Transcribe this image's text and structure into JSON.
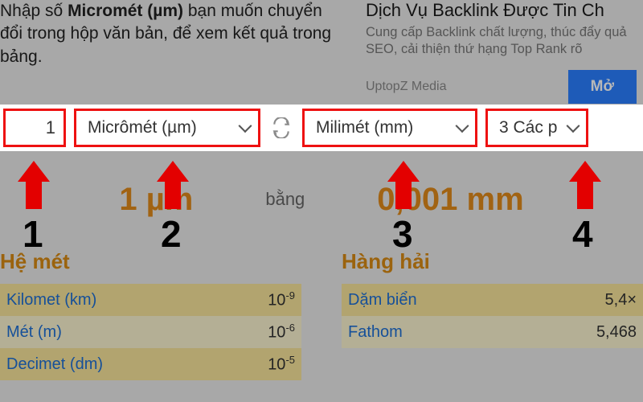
{
  "intro": {
    "line_pre": "Nhập số ",
    "bold": "Micromét (µm)",
    "line_post1": " bạn muốn chuyển",
    "line2": "đổi trong hộp văn bản, để xem kết quả trong",
    "line3": "bảng."
  },
  "ad": {
    "title": "Dịch Vụ Backlink Được Tin Ch",
    "desc": "Cung cấp Backlink chất lượng, thúc đẩy quả SEO, cải thiện thứ hạng Top Rank rõ",
    "brand": "UptopZ Media",
    "cta": "Mở"
  },
  "converter": {
    "input_value": "1",
    "from_label": "Micrômét (µm)",
    "to_label": "Milimét (mm)",
    "precision_label": "3 Các p"
  },
  "result": {
    "left": "1 µm",
    "eq": "bằng",
    "right": "0,001 mm"
  },
  "sections": {
    "metric_title": "Hệ mét",
    "nautical_title": "Hàng hải",
    "metric_rows": [
      {
        "label": "Kilomet (km)",
        "value_base": "10",
        "value_exp": "-9"
      },
      {
        "label": "Mét (m)",
        "value_base": "10",
        "value_exp": "-6"
      },
      {
        "label": "Decimet (dm)",
        "value_base": "10",
        "value_exp": "-5"
      }
    ],
    "nautical_rows": [
      {
        "label": "Dặm biển",
        "value": "5,4×"
      },
      {
        "label": "Fathom",
        "value": "5,468"
      }
    ]
  },
  "annotations": {
    "n1": "1",
    "n2": "2",
    "n3": "3",
    "n4": "4"
  }
}
